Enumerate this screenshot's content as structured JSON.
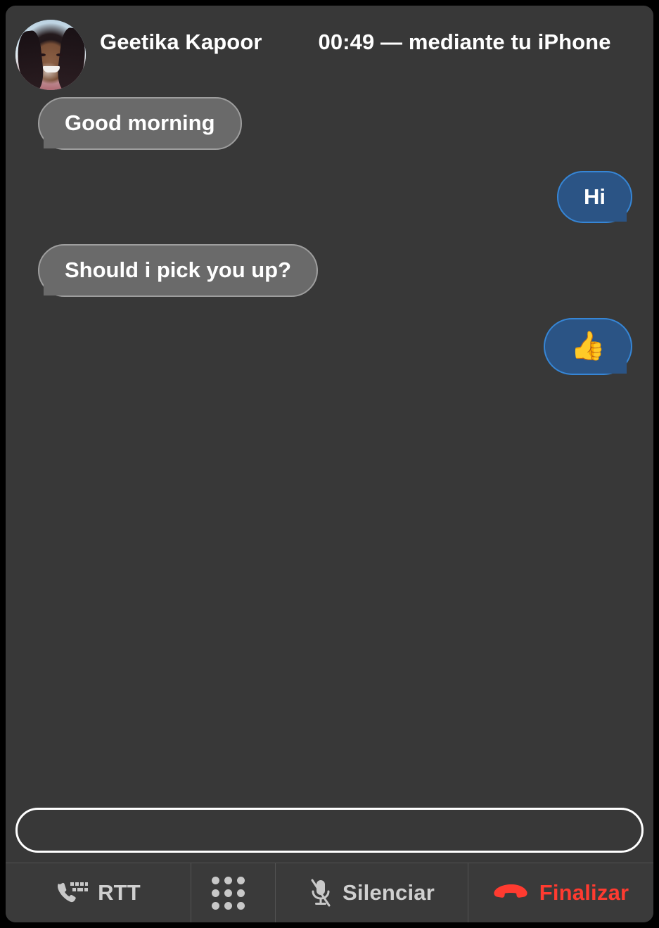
{
  "window": {
    "background_color": "#383838",
    "outer_color": "#000000"
  },
  "header": {
    "contact_name": "Geetika Kapoor",
    "call_status": "00:49 — mediante tu iPhone",
    "avatar_alt": "avatar"
  },
  "transcript": {
    "messages": [
      {
        "direction": "incoming",
        "text": "Good morning",
        "type": "text"
      },
      {
        "direction": "outgoing",
        "text": "Hi",
        "type": "text"
      },
      {
        "direction": "incoming",
        "text": "Should i pick you up?",
        "type": "text"
      },
      {
        "direction": "outgoing",
        "text": "👍",
        "type": "emoji"
      }
    ],
    "bubble_colors": {
      "incoming_fill": "#6a6a6a",
      "incoming_border": "#9e9e9e",
      "outgoing_fill": "#2b5485",
      "outgoing_border": "#3686d6",
      "text": "#ffffff"
    }
  },
  "composer": {
    "value": "",
    "placeholder": "",
    "focused": true,
    "border_color": "#ffffff"
  },
  "toolbar": {
    "buttons": [
      {
        "id": "rtt",
        "label": "RTT",
        "icon": "phone-keyboard-icon",
        "color": "#d0d0d0"
      },
      {
        "id": "keypad",
        "label": "",
        "icon": "keypad-icon",
        "color": "#c8c8c8"
      },
      {
        "id": "mute",
        "label": "Silenciar",
        "icon": "microphone-muted-icon",
        "color": "#d0d0d0"
      },
      {
        "id": "end",
        "label": "Finalizar",
        "icon": "end-call-icon",
        "color": "#ff3b30"
      }
    ]
  }
}
